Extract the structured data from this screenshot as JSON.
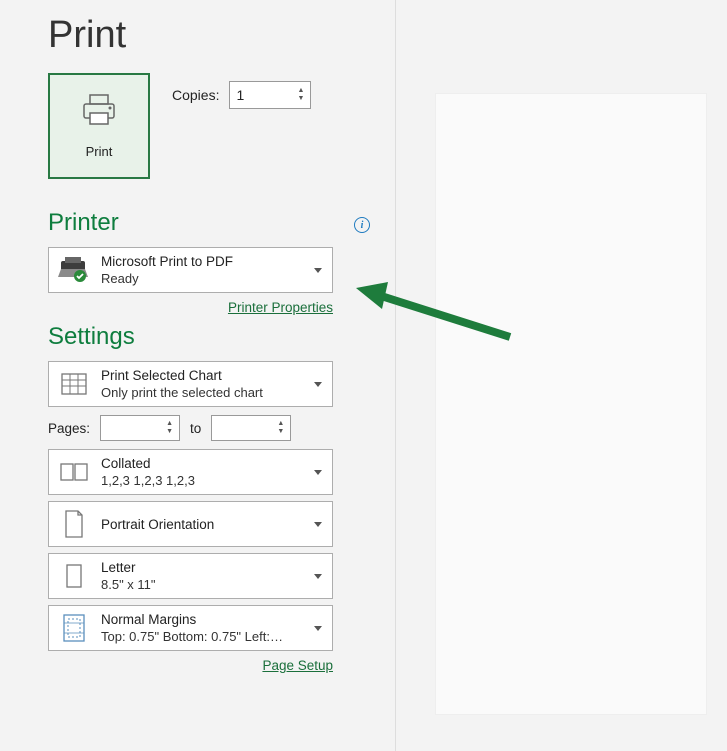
{
  "title": "Print",
  "printButton": {
    "label": "Print"
  },
  "copies": {
    "label": "Copies:",
    "value": "1"
  },
  "printerSection": {
    "heading": "Printer",
    "selected": {
      "name": "Microsoft Print to PDF",
      "status": "Ready"
    },
    "propertiesLink": "Printer Properties"
  },
  "settingsSection": {
    "heading": "Settings",
    "scope": {
      "title": "Print Selected Chart",
      "subtitle": "Only print the selected chart"
    },
    "pages": {
      "label": "Pages:",
      "from": "",
      "toLabel": "to",
      "to": ""
    },
    "collation": {
      "title": "Collated",
      "subtitle": "1,2,3    1,2,3    1,2,3"
    },
    "orientation": {
      "title": "Portrait Orientation"
    },
    "paper": {
      "title": "Letter",
      "subtitle": "8.5\" x 11\""
    },
    "margins": {
      "title": "Normal Margins",
      "subtitle": "Top: 0.75\" Bottom: 0.75\" Left:…"
    },
    "pageSetupLink": "Page Setup"
  }
}
